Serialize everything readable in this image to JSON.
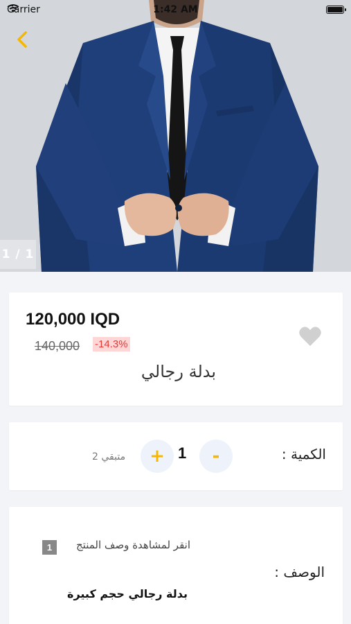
{
  "status_bar": {
    "carrier": "Carrier",
    "time": "1:42 AM"
  },
  "hero": {
    "image_counter": "1 / 1",
    "back_icon": "chevron-left-icon",
    "accent_color": "#f5b700"
  },
  "product": {
    "price": "120,000 IQD",
    "old_price": "140,000",
    "discount": "-14.3%",
    "name": "بدلة رجالي",
    "favorite_icon": "heart-icon"
  },
  "quantity": {
    "label": "الكمية :",
    "minus_label": "-",
    "plus_label": "+",
    "value": "1",
    "stock_text": "متبقي 2"
  },
  "description": {
    "view_prompt": "انقر لمشاهدة وصف المنتج",
    "badge": "1",
    "label": "الوصف :",
    "text": "بدلة رجالي حجم كبيرة"
  }
}
